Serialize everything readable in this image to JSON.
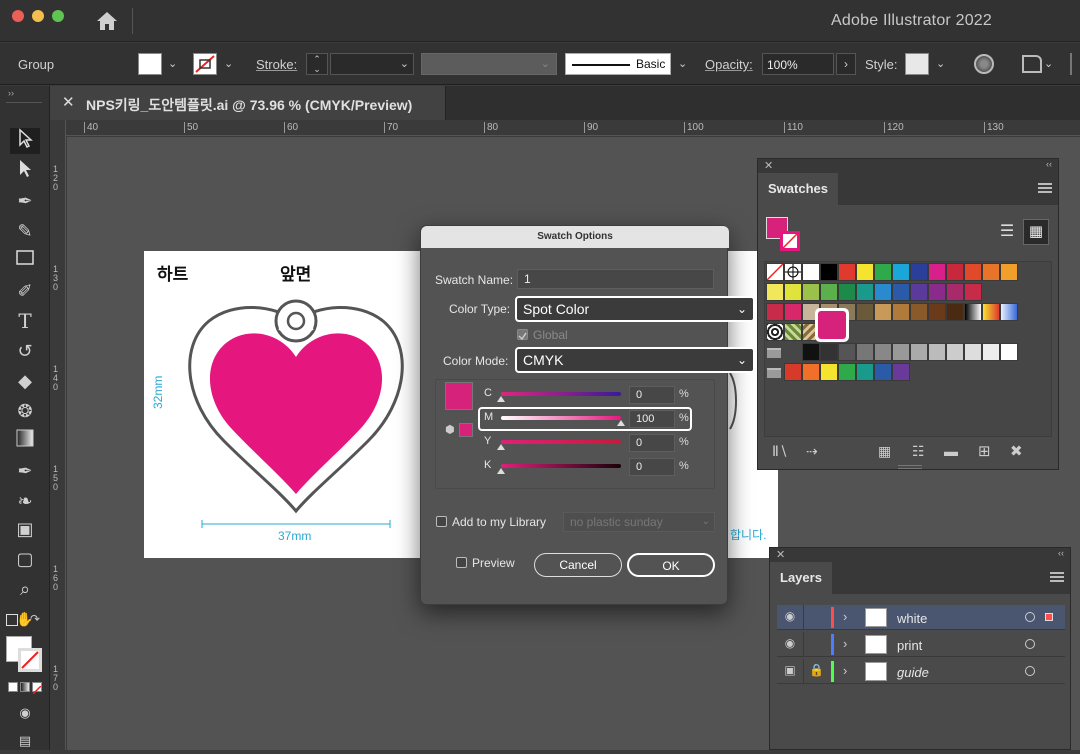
{
  "app": {
    "title": "Adobe Illustrator 2022"
  },
  "control_bar": {
    "selection_label": "Group",
    "stroke_label": "Stroke:",
    "brush_label": "Basic",
    "opacity_label": "Opacity:",
    "opacity_value": "100%",
    "style_label": "Style:"
  },
  "document_tab": {
    "title": "NPS키링_도안템플릿.ai @ 73.96 % (CMYK/Preview)"
  },
  "ruler": {
    "top_ticks": [
      "40",
      "50",
      "60",
      "70",
      "80",
      "90",
      "100",
      "110",
      "120",
      "130"
    ],
    "left_ticks": [
      "120",
      "130",
      "140",
      "150",
      "160",
      "170"
    ]
  },
  "artboard": {
    "label_left": "하트",
    "label_right": "앞면",
    "height_dim": "32mm",
    "width_dim": "37mm",
    "hidden_text": "합니다."
  },
  "swatch_dialog": {
    "title": "Swatch Options",
    "name_label": "Swatch Name:",
    "name_value": "1",
    "color_type_label": "Color Type:",
    "color_type_value": "Spot Color",
    "global_label": "Global",
    "color_mode_label": "Color Mode:",
    "color_mode_value": "CMYK",
    "channels": [
      {
        "label": "C",
        "value": "0"
      },
      {
        "label": "M",
        "value": "100"
      },
      {
        "label": "Y",
        "value": "0"
      },
      {
        "label": "K",
        "value": "0"
      }
    ],
    "percent_sign": "%",
    "library_label": "Add to my Library",
    "library_value": "no plastic sunday",
    "preview_label": "Preview",
    "cancel_label": "Cancel",
    "ok_label": "OK",
    "swatch_color": "#d6227a"
  },
  "swatches_panel": {
    "title": "Swatches",
    "selected_color": "#d6227a"
  },
  "layers_panel": {
    "title": "Layers",
    "layers": [
      {
        "name": "white",
        "color": "#ff4c4c"
      },
      {
        "name": "print",
        "color": "#4c7cff"
      },
      {
        "name": "guide",
        "color": "#4cff4c"
      }
    ]
  }
}
